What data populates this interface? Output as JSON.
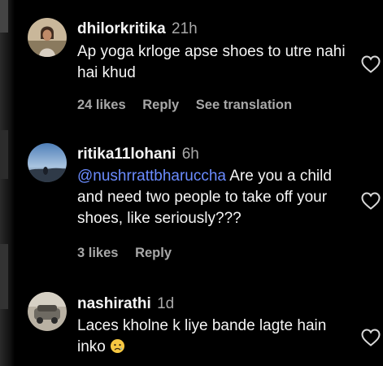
{
  "comments": [
    {
      "username": "dhilorkritika",
      "time": "21h",
      "text": "Ap yoga krloge apse shoes to utre nahi hai khud",
      "likes": "24 likes",
      "reply": "Reply",
      "translation": "See translation"
    },
    {
      "username": "ritika11lohani",
      "time": "6h",
      "mention": "@nushrrattbharuccha",
      "text": " Are you a child and need two people to take off your shoes, like seriously???",
      "likes": "3 likes",
      "reply": "Reply"
    },
    {
      "username": "nashirathi",
      "time": "1d",
      "text": "Laces kholne k liye bande lagte hain inko",
      "emoji": "crying-face-emoji"
    }
  ],
  "icons": {
    "like": "heart-outline-icon"
  },
  "colors": {
    "background": "#000000",
    "primary_text": "#f5f5f5",
    "secondary_text": "#a8a8a8",
    "mention": "#6b8cff"
  }
}
